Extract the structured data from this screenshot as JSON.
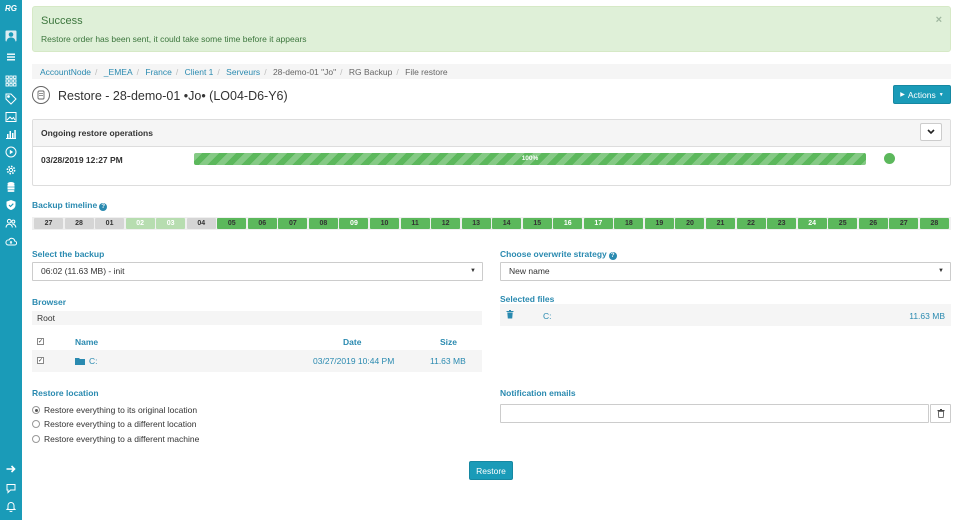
{
  "sidebar": {
    "logo": "RG",
    "items": [
      {
        "icon": "user-avatar-icon"
      },
      {
        "icon": "hamburger-menu-icon"
      },
      {
        "icon": "apps-grid-icon"
      },
      {
        "icon": "tag-icon"
      },
      {
        "icon": "image-icon"
      },
      {
        "icon": "bar-chart-icon"
      },
      {
        "icon": "play-circle-icon"
      },
      {
        "icon": "gear-icon"
      },
      {
        "icon": "database-icon"
      },
      {
        "icon": "shield-icon"
      },
      {
        "icon": "users-icon"
      },
      {
        "icon": "cloud-icon"
      }
    ],
    "bottom": [
      {
        "icon": "arrow-right-icon"
      },
      {
        "icon": "chat-icon"
      },
      {
        "icon": "bell-icon"
      }
    ]
  },
  "alert": {
    "title": "Success",
    "message": "Restore order has been sent, it could take some time before it appears",
    "close": "×"
  },
  "breadcrumb": {
    "items": [
      "AccountNode",
      "_EMEA",
      "France",
      "Client 1",
      "Serveurs"
    ],
    "rest": [
      "28-demo-01 \"Jo\"",
      "RG Backup",
      "File restore"
    ]
  },
  "header": {
    "title": "Restore - 28-demo-01 •Jo• (LO04-D6-Y6)",
    "actions_label": "Actions"
  },
  "ongoing": {
    "title": "Ongoing restore operations",
    "date": "03/28/2019 12:27 PM",
    "progress_label": "100%",
    "progress": 1.0,
    "status_color": "#5cb85c"
  },
  "timeline": {
    "label": "Backup timeline",
    "days": [
      {
        "d": "27",
        "s": "empty"
      },
      {
        "d": "28",
        "s": "empty"
      },
      {
        "d": "01",
        "s": "empty"
      },
      {
        "d": "02",
        "s": "partial"
      },
      {
        "d": "03",
        "s": "partial"
      },
      {
        "d": "04",
        "s": "empty"
      },
      {
        "d": "05",
        "s": "full"
      },
      {
        "d": "06",
        "s": "full"
      },
      {
        "d": "07",
        "s": "full"
      },
      {
        "d": "08",
        "s": "full"
      },
      {
        "d": "09",
        "s": "sel"
      },
      {
        "d": "10",
        "s": "full"
      },
      {
        "d": "11",
        "s": "full"
      },
      {
        "d": "12",
        "s": "full"
      },
      {
        "d": "13",
        "s": "full"
      },
      {
        "d": "14",
        "s": "full"
      },
      {
        "d": "15",
        "s": "full"
      },
      {
        "d": "16",
        "s": "sel"
      },
      {
        "d": "17",
        "s": "sel"
      },
      {
        "d": "18",
        "s": "full"
      },
      {
        "d": "19",
        "s": "full"
      },
      {
        "d": "20",
        "s": "full"
      },
      {
        "d": "21",
        "s": "full"
      },
      {
        "d": "22",
        "s": "full"
      },
      {
        "d": "23",
        "s": "full"
      },
      {
        "d": "24",
        "s": "sel"
      },
      {
        "d": "25",
        "s": "full"
      },
      {
        "d": "26",
        "s": "full"
      },
      {
        "d": "27",
        "s": "full"
      },
      {
        "d": "28",
        "s": "full"
      }
    ]
  },
  "backup": {
    "label": "Select the backup",
    "value": "06:02 (11.63 MB) - init"
  },
  "overwrite": {
    "label": "Choose overwrite strategy",
    "value": "New name"
  },
  "browser": {
    "label": "Browser",
    "root": "Root",
    "columns": {
      "name": "Name",
      "date": "Date",
      "size": "Size"
    },
    "rows": [
      {
        "name": "C:",
        "date": "03/27/2019 10:44 PM",
        "size": "11.63 MB"
      }
    ]
  },
  "selected_files": {
    "label": "Selected files",
    "rows": [
      {
        "name": "C:",
        "size": "11.63 MB"
      }
    ]
  },
  "restore_location": {
    "label": "Restore location",
    "options": [
      {
        "label": "Restore everything to its original location",
        "selected": true
      },
      {
        "label": "Restore everything to a different location",
        "selected": false
      },
      {
        "label": "Restore everything to a different machine",
        "selected": false
      }
    ]
  },
  "notification": {
    "label": "Notification emails",
    "value": ""
  },
  "restore_button": "Restore",
  "colors": {
    "sidebar": "#1a9bb8",
    "accent": "#2a8ab0",
    "success": "#5cb85c",
    "alert_bg": "#dff0d8"
  }
}
